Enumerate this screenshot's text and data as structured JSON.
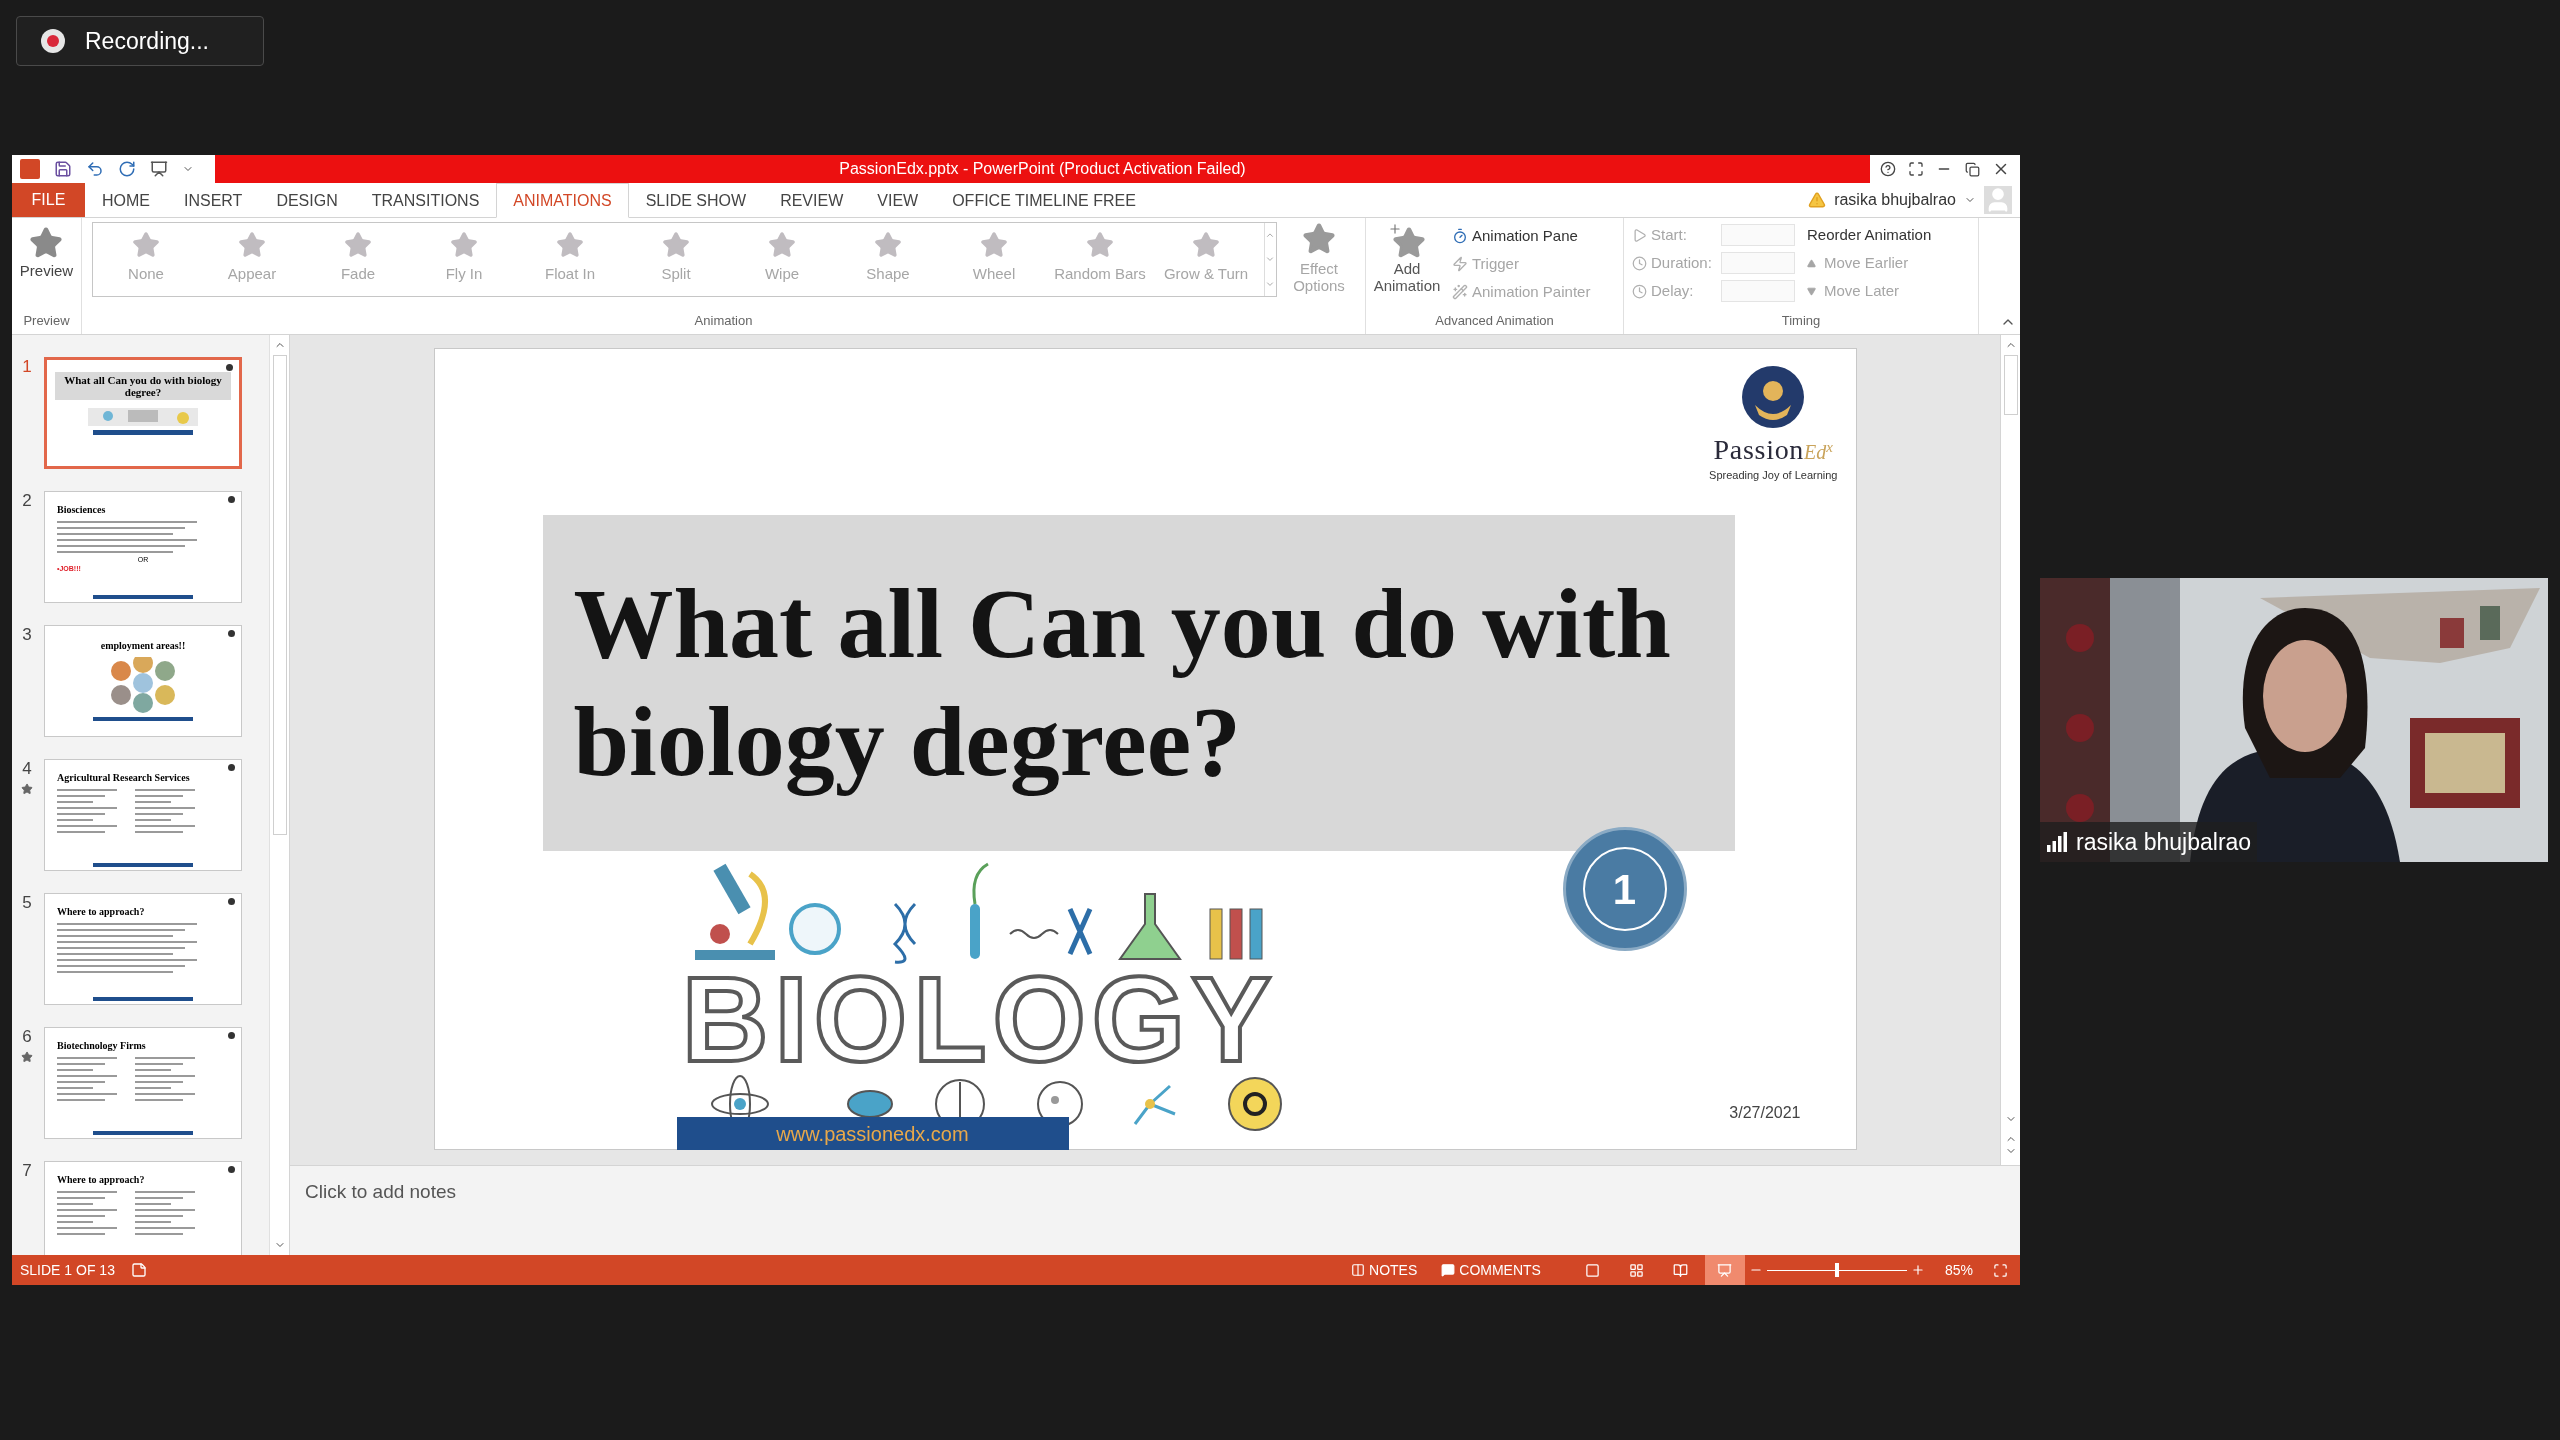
{
  "recording": {
    "label": "Recording..."
  },
  "window": {
    "title": "PassionEdx.pptx - PowerPoint (Product Activation Failed)"
  },
  "tabs": [
    {
      "label": "FILE",
      "kind": "file",
      "selected": false
    },
    {
      "label": "HOME",
      "kind": "tab",
      "selected": false
    },
    {
      "label": "INSERT",
      "kind": "tab",
      "selected": false
    },
    {
      "label": "DESIGN",
      "kind": "tab",
      "selected": false
    },
    {
      "label": "TRANSITIONS",
      "kind": "tab",
      "selected": false
    },
    {
      "label": "ANIMATIONS",
      "kind": "tab",
      "selected": true
    },
    {
      "label": "SLIDE SHOW",
      "kind": "tab",
      "selected": false
    },
    {
      "label": "REVIEW",
      "kind": "tab",
      "selected": false
    },
    {
      "label": "VIEW",
      "kind": "tab",
      "selected": false
    },
    {
      "label": "OFFICE TIMELINE FREE",
      "kind": "tab",
      "selected": false
    }
  ],
  "account": {
    "name": "rasika bhujbalrao"
  },
  "ribbon": {
    "preview": {
      "label": "Preview",
      "group": "Preview"
    },
    "gallery": {
      "disabled": true,
      "group": "Animation",
      "items": [
        {
          "label": "None"
        },
        {
          "label": "Appear"
        },
        {
          "label": "Fade"
        },
        {
          "label": "Fly In"
        },
        {
          "label": "Float In"
        },
        {
          "label": "Split"
        },
        {
          "label": "Wipe"
        },
        {
          "label": "Shape"
        },
        {
          "label": "Wheel"
        },
        {
          "label": "Random Bars"
        },
        {
          "label": "Grow & Turn"
        }
      ]
    },
    "effect_options": {
      "label": "Effect Options",
      "disabled": true
    },
    "add_animation": {
      "label": "Add Animation"
    },
    "advanced": {
      "group": "Advanced Animation",
      "items": [
        {
          "label": "Animation Pane",
          "disabled": false
        },
        {
          "label": "Trigger",
          "disabled": true
        },
        {
          "label": "Animation Painter",
          "disabled": true
        }
      ]
    },
    "timing": {
      "group": "Timing",
      "fields": [
        {
          "label": "Start:",
          "disabled": true
        },
        {
          "label": "Duration:",
          "disabled": true
        },
        {
          "label": "Delay:",
          "disabled": true
        }
      ],
      "reorder": {
        "title": "Reorder Animation",
        "items": [
          {
            "label": "Move Earlier",
            "disabled": true
          },
          {
            "label": "Move Later",
            "disabled": true
          }
        ]
      }
    }
  },
  "thumbnails": [
    {
      "number": "1",
      "kind": "title",
      "title": "What all Can you do with biology degree?",
      "selected": true,
      "animated": false
    },
    {
      "number": "2",
      "kind": "bullets",
      "title": "Biosciences",
      "selected": false,
      "animated": false,
      "notes": [
        {
          "text": "OR",
          "kind": "plain"
        },
        {
          "text": "•JOB!!!",
          "kind": "alert"
        }
      ]
    },
    {
      "number": "3",
      "kind": "hexagons",
      "title": "employment areas!!",
      "selected": false,
      "animated": false
    },
    {
      "number": "4",
      "kind": "columns",
      "title": "Agricultural Research Services",
      "selected": false,
      "animated": true
    },
    {
      "number": "5",
      "kind": "bullets",
      "title": "Where to approach?",
      "selected": false,
      "animated": false
    },
    {
      "number": "6",
      "kind": "columns",
      "title": "Biotechnology Firms",
      "selected": false,
      "animated": true
    },
    {
      "number": "7",
      "kind": "columns",
      "title": "Where to approach?",
      "selected": false,
      "animated": false
    }
  ],
  "slide": {
    "title": "What all Can you do with biology degree?",
    "lettering": "BIOLOGY",
    "badge": "1",
    "date": "3/27/2021",
    "url": "www.passionedx.com",
    "logo": {
      "name": "Passion",
      "suffix": "Ed$^{x}$",
      "tagline": "Spreading Joy of Learning"
    }
  },
  "notes": {
    "placeholder": "Click to add notes"
  },
  "status_bar": {
    "slide": "SLIDE 1 OF 13",
    "notes": "NOTES",
    "comments": "COMMENTS",
    "views": [
      {
        "kind": "normal",
        "selected": false
      },
      {
        "kind": "sorter",
        "selected": false
      },
      {
        "kind": "reading",
        "selected": false
      },
      {
        "kind": "show",
        "selected": true
      }
    ],
    "zoom": {
      "level": 0.5,
      "label": "85%"
    }
  },
  "participant": {
    "name": "rasika bhujbalrao"
  }
}
